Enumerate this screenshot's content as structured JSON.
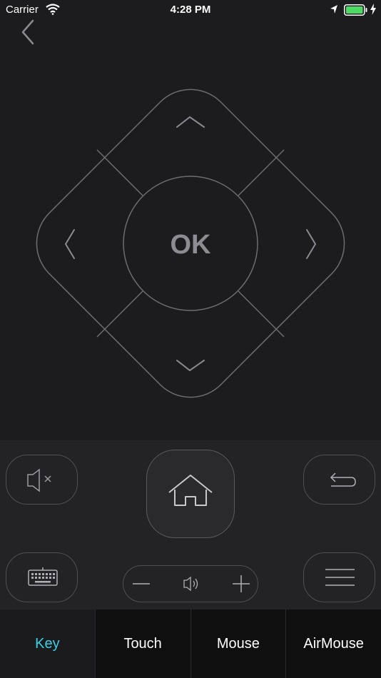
{
  "status_bar": {
    "carrier": "Carrier",
    "time": "4:28 PM"
  },
  "dpad": {
    "ok_label": "OK"
  },
  "tabs": [
    {
      "label": "Key",
      "active": true
    },
    {
      "label": "Touch",
      "active": false
    },
    {
      "label": "Mouse",
      "active": false
    },
    {
      "label": "AirMouse",
      "active": false
    }
  ],
  "colors": {
    "accent": "#39d0e6",
    "stroke": "#6c6c72",
    "background": "#1c1c1e",
    "battery": "#4cd964"
  },
  "icons": [
    "back-chevron-icon",
    "wifi-icon",
    "location-arrow-icon",
    "battery-icon",
    "charging-bolt-icon",
    "mute-icon",
    "home-icon",
    "return-icon",
    "keyboard-icon",
    "menu-icon",
    "volume-icon",
    "minus-icon",
    "plus-icon"
  ]
}
